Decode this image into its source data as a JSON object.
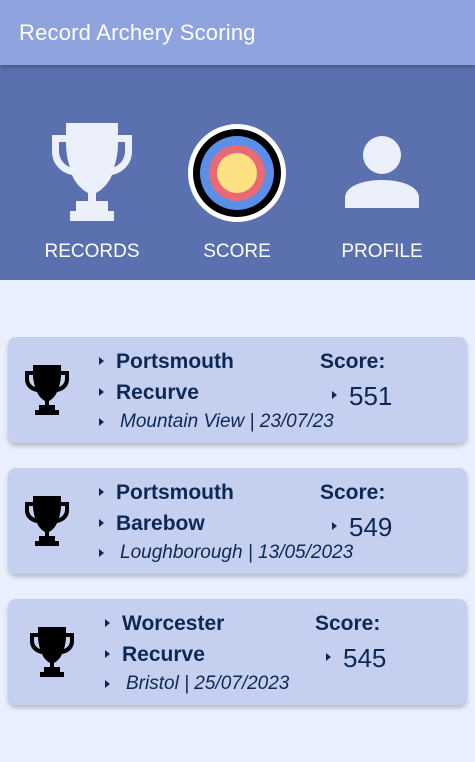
{
  "app": {
    "title": "Record Archery Scoring"
  },
  "nav": {
    "items": [
      {
        "label": "RECORDS",
        "icon": "trophy-icon"
      },
      {
        "label": "SCORE",
        "icon": "target-icon"
      },
      {
        "label": "PROFILE",
        "icon": "person-icon"
      }
    ]
  },
  "colors": {
    "appbar": "#8fa4df",
    "nav_panel": "#5b70ae",
    "card": "#c5d0f0",
    "text": "#0e2855"
  },
  "records": [
    {
      "location": "Portsmouth",
      "bow": "Recurve",
      "details": "Mountain View | 23/07/23",
      "score_label": "Score:",
      "score": "551"
    },
    {
      "location": "Portsmouth",
      "bow": "Barebow",
      "details": "Loughborough | 13/05/2023",
      "score_label": "Score:",
      "score": "549"
    },
    {
      "location": "Worcester",
      "bow": "Recurve",
      "details": "Bristol | 25/07/2023",
      "score_label": "Score:",
      "score": "545"
    }
  ]
}
